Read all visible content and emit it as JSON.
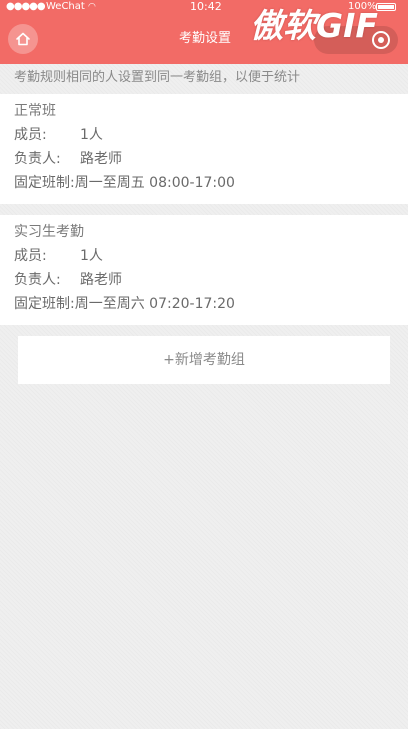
{
  "status": {
    "signal": "●●●●●",
    "carrier": "WeChat",
    "time": "10:42",
    "battery": "100%"
  },
  "header": {
    "title": "考勤设置",
    "watermark": "傲软GIF",
    "background_color": "#f26b66"
  },
  "tip": "考勤规则相同的人设置到同一考勤组，以便于统计",
  "groups": [
    {
      "name": "正常班",
      "member_label": "成员:",
      "member_value": "1人",
      "owner_label": "负责人:",
      "owner_value": "路老师",
      "schedule_label": "固定班制:",
      "schedule_value": "周一至周五 08:00-17:00"
    },
    {
      "name": "实习生考勤",
      "member_label": "成员:",
      "member_value": "1人",
      "owner_label": "负责人:",
      "owner_value": "路老师",
      "schedule_label": "固定班制:",
      "schedule_value": "周一至周六 07:20-17:20"
    }
  ],
  "add_button": "+新增考勤组"
}
